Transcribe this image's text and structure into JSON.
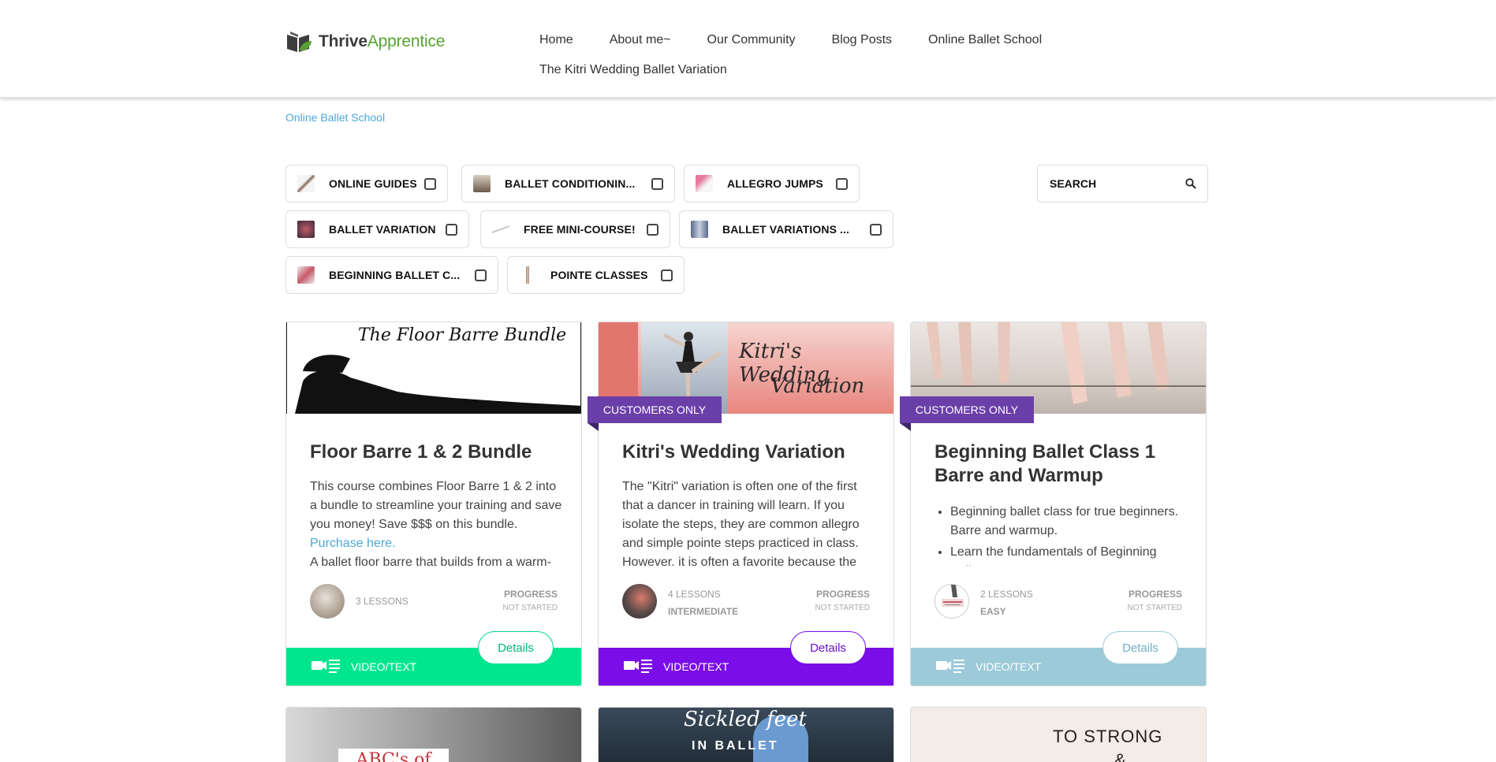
{
  "header": {
    "logo_bold": "Thrive",
    "logo_light": "Apprentice",
    "nav": [
      {
        "label": "Home"
      },
      {
        "label": "About me~"
      },
      {
        "label": "Our Community"
      },
      {
        "label": "Blog Posts"
      },
      {
        "label": "Online Ballet School"
      },
      {
        "label": "The Kitri Wedding Ballet Variation"
      }
    ]
  },
  "breadcrumb": "Online Ballet School",
  "filters": [
    {
      "label": "ONLINE GUIDES"
    },
    {
      "label": "BALLET CONDITIONIN..."
    },
    {
      "label": "ALLEGRO JUMPS"
    },
    {
      "label": "BALLET VARIATION"
    },
    {
      "label": "FREE MINI-COURSE!"
    },
    {
      "label": "BALLET VARIATIONS ..."
    },
    {
      "label": "BEGINNING BALLET C..."
    },
    {
      "label": "POINTE CLASSES"
    }
  ],
  "search": {
    "placeholder": "SEARCH"
  },
  "cards": [
    {
      "image_text": "The Floor Barre Bundle",
      "title": "Floor Barre 1 & 2 Bundle",
      "desc_text": "This course combines Floor Barre 1 & 2 into a bundle to streamline your training and save you money! Save $$$ on this bundle.",
      "desc_link": "Purchase here.",
      "desc_more": "A ballet floor barre that builds from a warm-",
      "lessons": "3 LESSONS",
      "progress_label": "PROGRESS",
      "progress_status": "NOT STARTED",
      "details": "Details",
      "footer": "VIDEO/TEXT",
      "color": "#00e68f"
    },
    {
      "badge": "CUSTOMERS ONLY",
      "image_text_1": "Kitri's Wedding",
      "image_text_2": "Variation",
      "title": "Kitri's Wedding Variation",
      "desc_text": "The \"Kitri\" variation is often one of the first that a dancer in training will learn. If you isolate the steps, they are common allegro and simple pointe steps practiced in class. However, it is often a favorite because the",
      "lessons": "4 LESSONS",
      "level": "INTERMEDIATE",
      "progress_label": "PROGRESS",
      "progress_status": "NOT STARTED",
      "details": "Details",
      "footer": "VIDEO/TEXT",
      "color": "#7b0ee8"
    },
    {
      "badge": "CUSTOMERS ONLY",
      "title": "Beginning Ballet Class 1 Barre and Warmup",
      "bullets": [
        "Beginning ballet class for true beginners. Barre and warmup.",
        "Learn the fundamentals of Beginning Ballet"
      ],
      "lessons": "2 LESSONS",
      "level": "EASY",
      "progress_label": "PROGRESS",
      "progress_status": "NOT STARTED",
      "details": "Details",
      "footer": "VIDEO/TEXT",
      "color": "#9ccad8"
    }
  ],
  "peek_cards": [
    {
      "image_text": "ABC's of"
    },
    {
      "image_text_1": "Sickled feet",
      "image_text_2": "IN BALLET"
    },
    {
      "image_text_1": "TO STRONG",
      "image_text_2": "&"
    }
  ],
  "colors": {
    "accent_link": "#4aa9d6",
    "badge": "#6b3fa8",
    "logo_green": "#58a232"
  }
}
